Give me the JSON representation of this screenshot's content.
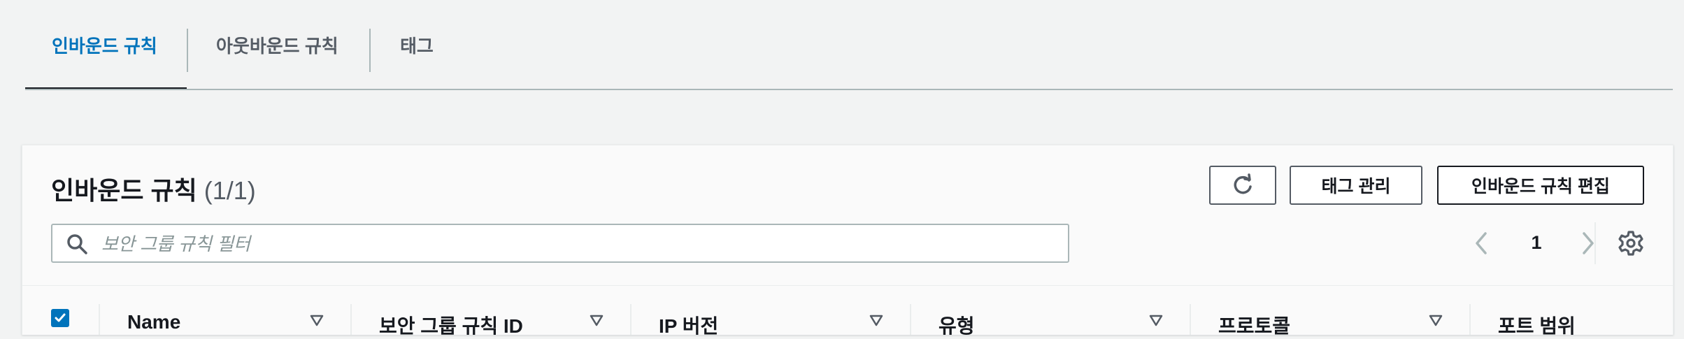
{
  "tabs": [
    {
      "label": "인바운드 규칙",
      "active": true
    },
    {
      "label": "아웃바운드 규칙",
      "active": false
    },
    {
      "label": "태그",
      "active": false
    }
  ],
  "panel": {
    "title": "인바운드 규칙",
    "count": "(1/1)",
    "refresh_icon": "refresh-icon",
    "manage_tags_label": "태그 관리",
    "edit_inbound_label": "인바운드 규칙 편집",
    "search_placeholder": "보안 그룹 규칙 필터",
    "search_value": "",
    "page": "1"
  },
  "table": {
    "select_all_checked": true,
    "columns": [
      "Name",
      "보안 그룹 규칙 ID",
      "IP 버전",
      "유형",
      "프로토콜",
      "포트 범위"
    ]
  },
  "colors": {
    "accent": "#0073bb",
    "text": "#16191f",
    "secondary": "#545b64"
  }
}
